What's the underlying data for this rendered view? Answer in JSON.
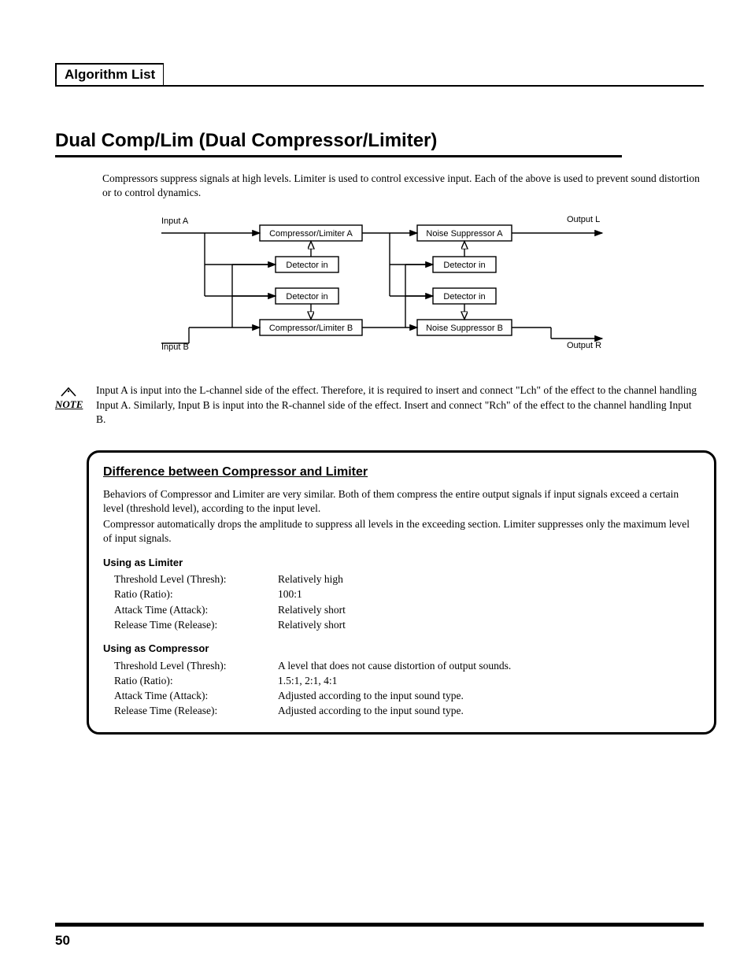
{
  "header": "Algorithm List",
  "title": "Dual Comp/Lim (Dual Compressor/Limiter)",
  "intro": "Compressors suppress signals at high levels. Limiter is used to control excessive input. Each of the above is used to prevent sound distortion or to control dynamics.",
  "diagram": {
    "input_a": "Input A",
    "input_b": "Input B",
    "cl_a": "Compressor/Limiter A",
    "cl_b": "Compressor/Limiter B",
    "ns_a": "Noise Suppressor A",
    "ns_b": "Noise Suppressor B",
    "det": "Detector in",
    "out_l": "Output L",
    "out_r": "Output R"
  },
  "note_icon": "NOTE",
  "note": "Input A is input into the L-channel side of the effect. Therefore, it is required to insert and connect \"Lch\" of the effect to the channel handling Input A. Similarly, Input B is input into the R-channel side of the effect. Insert and connect \"Rch\" of the effect to the channel handling Input B.",
  "callout": {
    "heading": "Difference between Compressor and Limiter",
    "para1": "Behaviors of Compressor and Limiter are very similar. Both of them compress the entire output signals if input signals exceed a certain level (threshold level), according to the input level.",
    "para2": "Compressor automatically drops the amplitude to suppress all levels in the exceeding section. Limiter suppresses only the maximum level of input signals.",
    "lim_title": "Using as Limiter",
    "lim": {
      "k1": "Threshold Level (Thresh):",
      "v1": "Relatively high",
      "k2": "Ratio (Ratio):",
      "v2": "100:1",
      "k3": "Attack Time (Attack):",
      "v3": "Relatively short",
      "k4": "Release Time (Release):",
      "v4": "Relatively short"
    },
    "cmp_title": "Using as Compressor",
    "cmp": {
      "k1": "Threshold Level (Thresh):",
      "v1": "A level that does not cause distortion of output sounds.",
      "k2": "Ratio (Ratio):",
      "v2": "1.5:1, 2:1, 4:1",
      "k3": "Attack Time (Attack):",
      "v3": "Adjusted according to the input sound type.",
      "k4": "Release Time (Release):",
      "v4": "Adjusted according to the input sound type."
    }
  },
  "page_number": "50"
}
